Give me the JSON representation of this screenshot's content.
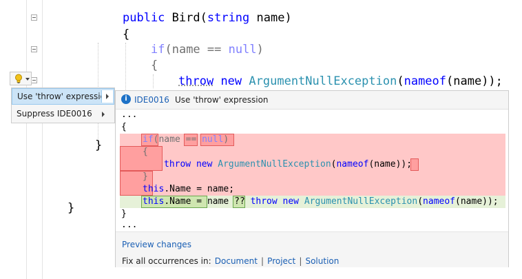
{
  "editor": {
    "line1": {
      "kw": "public",
      "name": "Bird(",
      "type_kw": "string",
      "param": " name)"
    },
    "line2": "{",
    "line3": {
      "kw": "if",
      "rest1": "(name == ",
      "null_kw": "null",
      "rest2": ")"
    },
    "line4": "{",
    "line5": {
      "throw_kw": "throw",
      "new_kw": "new",
      "type": "ArgumentNullException",
      "nameof_kw": "nameof",
      "arg": "(name));"
    },
    "brace_inner": "}",
    "brace_outer": "}"
  },
  "lightbulb": {
    "icon": "lightbulb-icon",
    "dropdown": "chevron-down-icon"
  },
  "menu": {
    "items": [
      {
        "label": "Use 'throw' expression",
        "selected": true
      },
      {
        "label": "Suppress IDE0016",
        "selected": false
      }
    ]
  },
  "preview": {
    "header": {
      "id": "IDE0016",
      "title": "Use 'throw' expression"
    },
    "lines": {
      "ellipsis_top": "...",
      "open": "{",
      "if_kw": "if",
      "if_rest": "(name == ",
      "null_kw": "null",
      "if_close": ")",
      "inner_open": "{",
      "throw_kw": "throw",
      "new_kw": "new",
      "exc_type": "ArgumentNullException",
      "nameof_kw": "nameof",
      "throw_rest": "(name));",
      "inner_close": "}",
      "this_kw": "this",
      "assign_old": ".Name = name;",
      "assign_new_a": ".Name = ",
      "assign_new_b": "name ",
      "coalesce": "??",
      "close": "}",
      "ellipsis_bottom": "..."
    },
    "footer": {
      "preview_changes": "Preview changes",
      "fix_all_label": "Fix all occurrences in:",
      "scopes": [
        "Document",
        "Project",
        "Solution"
      ],
      "separator": "|"
    }
  },
  "colors": {
    "keyword": "#0000ff",
    "type": "#2b91af",
    "removed": "#ffc8c8",
    "added": "#e6f1d8",
    "link": "#1a5fb4"
  }
}
